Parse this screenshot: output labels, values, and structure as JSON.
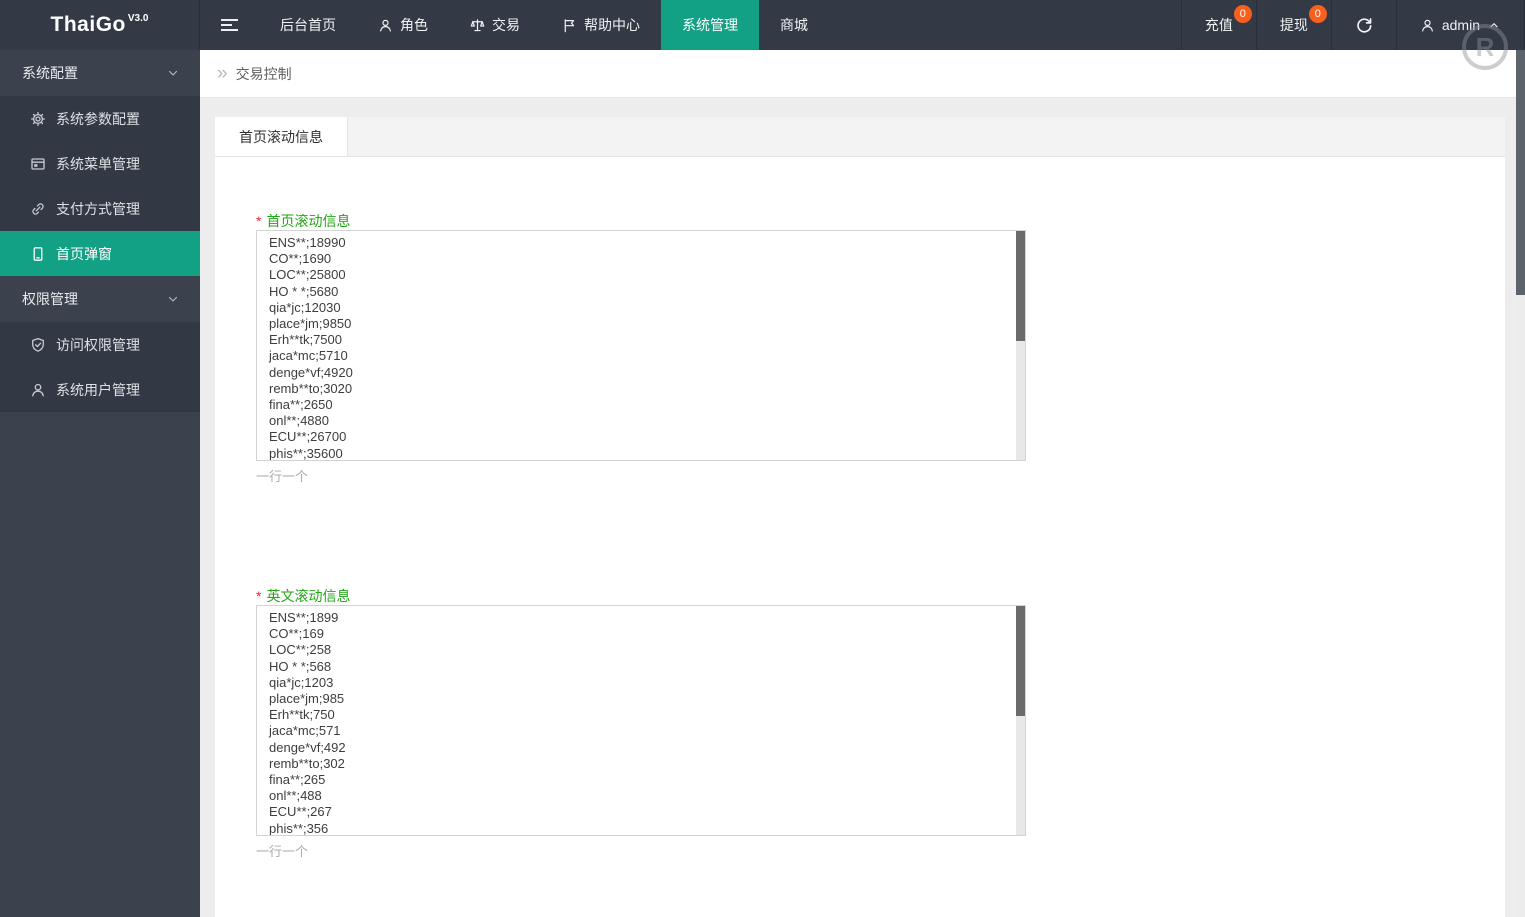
{
  "navbar": {
    "logo": {
      "name": "ThaiGo",
      "version": "V3.0"
    },
    "menu_items": [
      {
        "label": "后台首页",
        "icon": "none",
        "active": false
      },
      {
        "label": "角色",
        "icon": "person-icon",
        "active": false
      },
      {
        "label": "交易",
        "icon": "scales-icon",
        "active": false
      },
      {
        "label": "帮助中心",
        "icon": "flag-icon",
        "active": false
      },
      {
        "label": "系统管理",
        "icon": "none",
        "active": true
      },
      {
        "label": "商城",
        "icon": "none",
        "active": false
      }
    ],
    "recharge": {
      "label": "充值",
      "badge": "0"
    },
    "withdraw": {
      "label": "提现",
      "badge": "0"
    },
    "refresh_icon": "refresh-icon",
    "user": {
      "name": "admin",
      "icon": "person-icon",
      "caret": "caret-up-icon"
    },
    "watermark": "R"
  },
  "sidebar": {
    "groups": [
      {
        "label": "系统配置",
        "items": [
          {
            "label": "系统参数配置",
            "icon": "gear-icon",
            "active": false
          },
          {
            "label": "系统菜单管理",
            "icon": "window-icon",
            "active": false
          },
          {
            "label": "支付方式管理",
            "icon": "link-icon",
            "active": false
          },
          {
            "label": "首页弹窗",
            "icon": "tablet-icon",
            "active": true
          }
        ]
      },
      {
        "label": "权限管理",
        "items": [
          {
            "label": "访问权限管理",
            "icon": "shield-check-icon",
            "active": false
          },
          {
            "label": "系统用户管理",
            "icon": "person-icon",
            "active": false
          }
        ]
      }
    ]
  },
  "breadcrumb": {
    "current": "交易控制"
  },
  "content": {
    "active_tab": "首页滚动信息",
    "fields": [
      {
        "label": "首页滚动信息",
        "required_mark": "*",
        "hint": "一行一个",
        "value": "ENS**;18990\nCO**;1690\nLOC**;25800\nHO * *;5680\nqia*jc;12030\nplace*jm;9850\nErh**tk;7500\njaca*mc;5710\ndenge*vf;4920\nremb**to;3020\nfina**;2650\nonl**;4880\nECU**;26700\nphis**;35600"
      },
      {
        "label": "英文滚动信息",
        "required_mark": "*",
        "hint": "一行一个",
        "value": "ENS**;1899\nCO**;169\nLOC**;258\nHO * *;568\nqia*jc;1203\nplace*jm;985\nErh**tk;750\njaca*mc;571\ndenge*vf;492\nremb**to;302\nfina**;265\nonl**;488\nECU**;267\nphis**;356"
      }
    ]
  },
  "colors": {
    "navbar_bg": "#333a46",
    "sidebar_bg": "#3b424e",
    "sidebar_submenu_bg": "#323945",
    "accent_teal": "#13a185",
    "badge_orange": "#f95f1d",
    "label_green": "#21a616",
    "required_red": "#f5222d"
  }
}
